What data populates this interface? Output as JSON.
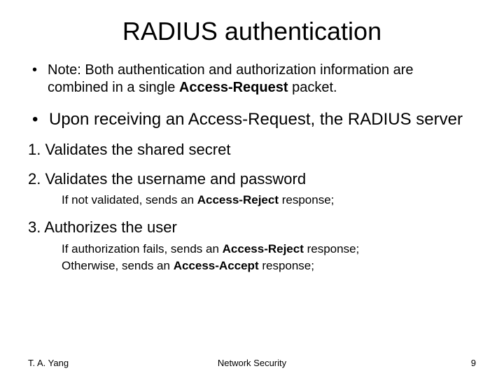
{
  "title": "RADIUS authentication",
  "b1_pre": "Note: Both authentication and authorization information are combined in a single ",
  "b1_bold": "Access-Request",
  "b1_post": " packet.",
  "b2": "Upon receiving an Access-Request, the RADIUS server",
  "n1": "1. Validates the shared secret",
  "n2": "2. Validates the username and password",
  "n2s_pre": "If not validated, sends an ",
  "n2s_bold": "Access-Reject",
  "n2s_post": " response;",
  "n3": "3. Authorizes the user",
  "n3s1_pre": "If authorization fails, sends an ",
  "n3s1_bold": "Access-Reject",
  "n3s1_post": " response;",
  "n3s2_pre": "Otherwise, sends an ",
  "n3s2_bold": "Access-Accept",
  "n3s2_post": " response;",
  "footer_left": "T. A. Yang",
  "footer_center": "Network Security",
  "footer_right": "9"
}
